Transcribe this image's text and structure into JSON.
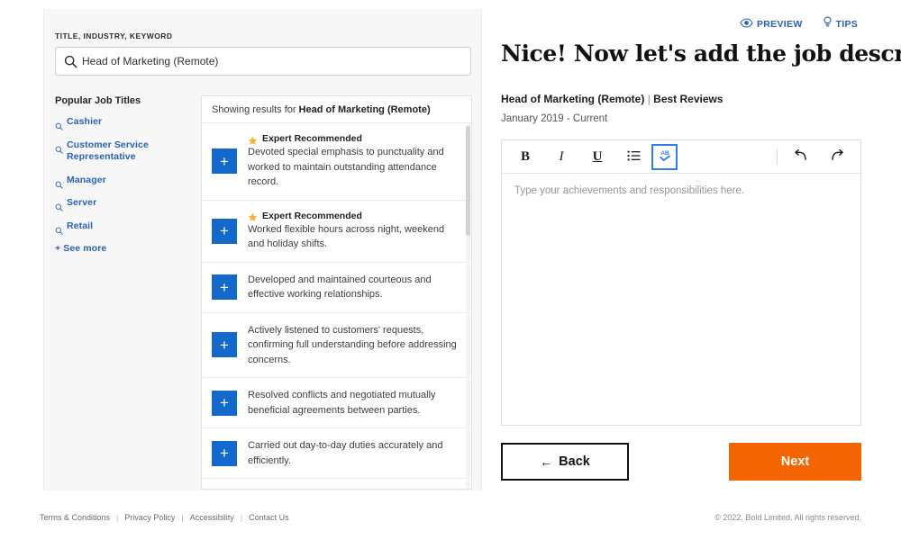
{
  "search": {
    "label": "TITLE, INDUSTRY, KEYWORD",
    "value": "Head of Marketing (Remote)",
    "icon": "search-icon"
  },
  "sidebar": {
    "title": "Popular Job Titles",
    "items": [
      {
        "label": "Cashier",
        "icon": "search-icon"
      },
      {
        "label": "Customer Service Representative",
        "icon": "search-icon"
      },
      {
        "label": "Manager",
        "icon": "search-icon"
      },
      {
        "label": "Server",
        "icon": "search-icon"
      },
      {
        "label": "Retail",
        "icon": "search-icon"
      }
    ],
    "see_more": "+ See more"
  },
  "results": {
    "header_prefix": "Showing results for",
    "header_query": "Head of Marketing (Remote)",
    "add_icon": "plus-icon",
    "recommended_badge": "Expert Recommended",
    "recommended_icon": "star-icon",
    "items": [
      {
        "recommended": true,
        "text": "Devoted special emphasis to punctuality and worked to maintain outstanding attendance record."
      },
      {
        "recommended": true,
        "text": "Worked flexible hours across night, weekend and holiday shifts."
      },
      {
        "recommended": false,
        "text": "Developed and maintained courteous and effective working relationships."
      },
      {
        "recommended": false,
        "text": "Actively listened to customers' requests, confirming full understanding before addressing concerns."
      },
      {
        "recommended": false,
        "text": "Resolved conflicts and negotiated mutually beneficial agreements between parties."
      },
      {
        "recommended": false,
        "text": "Carried out day-to-day duties accurately and efficiently."
      }
    ]
  },
  "top_actions": [
    {
      "label": "PREVIEW",
      "icon": "eye-icon"
    },
    {
      "label": "TIPS",
      "icon": "lightbulb-icon"
    }
  ],
  "main": {
    "headline": "Nice! Now let's add the job description",
    "job_title": "Head of Marketing (Remote)",
    "separator": "|",
    "company": "Best Reviews",
    "dates": "January 2019 - Current"
  },
  "editor": {
    "placeholder": "Type your achievements and responsibilities here.",
    "value": "",
    "toolbar": [
      {
        "name": "bold",
        "label": "B",
        "active": false
      },
      {
        "name": "italic",
        "label": "I",
        "active": false
      },
      {
        "name": "underline",
        "label": "U",
        "active": false
      },
      {
        "name": "bulleted-list",
        "label": "",
        "active": false
      },
      {
        "name": "spellcheck",
        "label": "",
        "active": true
      },
      {
        "name": "undo",
        "label": "",
        "active": false
      },
      {
        "name": "redo",
        "label": "",
        "active": false
      }
    ]
  },
  "nav": {
    "back_label": "Back",
    "back_arrow": "←",
    "next_label": "Next"
  },
  "footer": {
    "links": [
      "Terms & Conditions",
      "Privacy Policy",
      "Accessibility",
      "Contact Us"
    ],
    "separator": "|",
    "copyright": "© 2022, Bold Limited. All rights reserved."
  },
  "colors": {
    "accent_blue": "#1268cb",
    "link_blue": "#2a61b5",
    "next_orange": "#f26500",
    "star_gold": "#f5b335",
    "panel_gray": "#f7f7f8"
  }
}
